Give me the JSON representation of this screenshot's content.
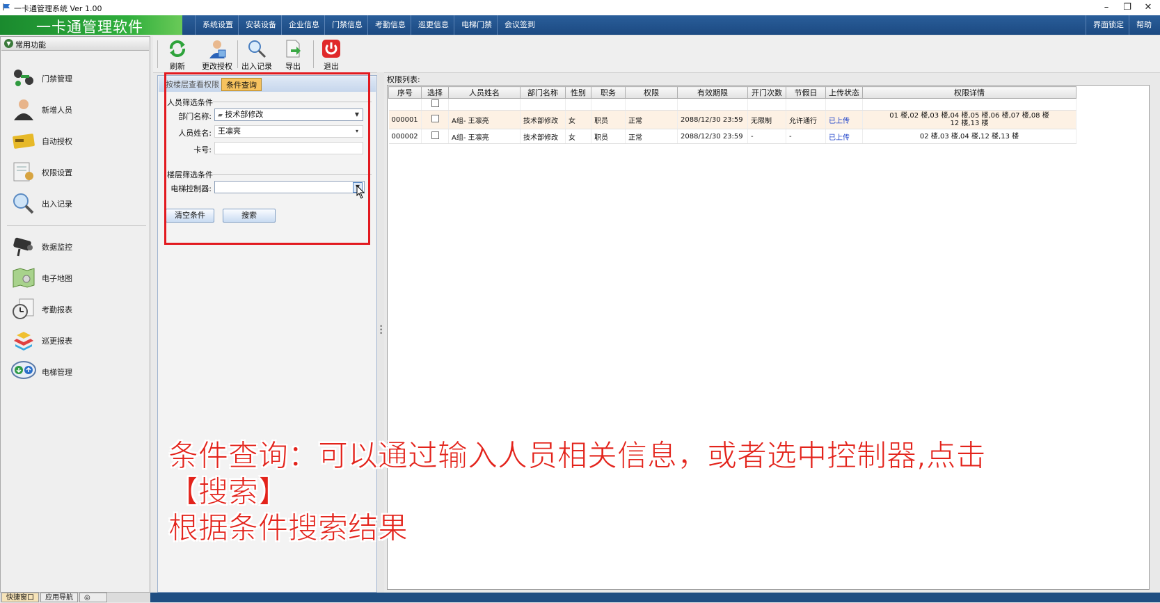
{
  "window": {
    "title": "一卡通管理系统 Ver 1.00"
  },
  "brand": {
    "text": "一卡通管理软件"
  },
  "menu": [
    "系统设置",
    "安装设备",
    "企业信息",
    "门禁信息",
    "考勤信息",
    "巡更信息",
    "电梯门禁",
    "会议签到"
  ],
  "menu_right": [
    "界面锁定",
    "帮助"
  ],
  "sidebar": {
    "header": "常用功能",
    "items": [
      "门禁管理",
      "新增人员",
      "自动授权",
      "权限设置",
      "出入记录",
      "数据监控",
      "电子地图",
      "考勤报表",
      "巡更报表",
      "电梯管理"
    ]
  },
  "bottom_tabs": [
    "快捷窗口",
    "应用导航"
  ],
  "toolbar": [
    "刷新",
    "更改授权",
    "出入记录",
    "导出",
    "退出"
  ],
  "query": {
    "tabs": [
      "按楼层查看权限",
      "条件查询"
    ],
    "person_section": "人员筛选条件",
    "dept_label": "部门名称:",
    "dept_value": "技术部修改",
    "name_label": "人员姓名:",
    "name_value": "王凛亮",
    "card_label": "卡号:",
    "card_value": "",
    "floor_section": "楼层筛选条件",
    "elevator_label": "电梯控制器:",
    "elevator_value": "",
    "clear_btn": "清空条件",
    "search_btn": "搜索"
  },
  "list": {
    "label": "权限列表:",
    "columns": [
      "序号",
      "选择",
      "人员姓名",
      "部门名称",
      "性别",
      "职务",
      "权限",
      "有效期限",
      "开门次数",
      "节假日",
      "上传状态",
      "权限详情"
    ],
    "rows": [
      {
        "no": "000001",
        "name": "A组- 王凛亮",
        "dept": "技术部修改",
        "gender": "女",
        "title": "职员",
        "perm": "正常",
        "expire": "2088/12/30 23:59",
        "times": "无限制",
        "holiday": "允许通行",
        "status": "已上传",
        "detail1": "01 楼,02 楼,03 楼,04 楼,05 楼,06 楼,07 楼,08 楼",
        "detail2": "12 楼,13 楼"
      },
      {
        "no": "000002",
        "name": "A组- 王凛亮",
        "dept": "技术部修改",
        "gender": "女",
        "title": "职员",
        "perm": "正常",
        "expire": "2088/12/30 23:59",
        "times": "-",
        "holiday": "-",
        "status": "已上传",
        "detail1": "02 楼,03 楼,04 楼,12 楼,13 楼",
        "detail2": ""
      }
    ]
  },
  "caption": {
    "line1": "条件查询：可以通过输入人员相关信息，或者选中控制器,点击【搜索】",
    "line2": "根据条件搜索结果"
  },
  "colors": {
    "menubar": "#1f4e82",
    "brand": "#2fae3c",
    "highlight": "#e2191f",
    "uploaded": "#1a3fc9"
  }
}
